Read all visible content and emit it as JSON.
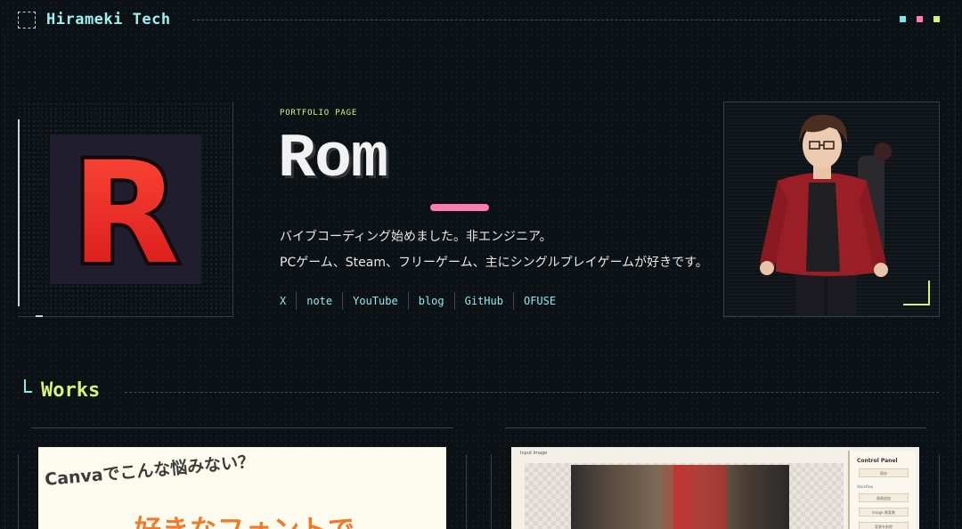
{
  "header": {
    "brand": "Hirameki Tech",
    "accent_squares": [
      "#7fe6e8",
      "#ff7ab0",
      "#d9f27a"
    ]
  },
  "hero": {
    "eyebrow": "PORTFOLIO PAGE",
    "name": "Rom",
    "avatar_letter": "R",
    "description": [
      "バイブコーディング始めました。非エンジニア。",
      "PCゲーム、Steam、フリーゲーム、主にシングルプレイゲームが好きです。"
    ],
    "links": [
      "X",
      "note",
      "YouTube",
      "blog",
      "GitHub",
      "OFUSE"
    ]
  },
  "works": {
    "title": "Works",
    "cards": [
      {
        "headline": "Canvaでこんな悩みない？",
        "subheadline": "好きなフォントで"
      },
      {
        "caption": "Input Image",
        "panel_title": "Control Panel",
        "panel_button": "保存",
        "panel_label": "Workflow",
        "panel_button2": "画像追加",
        "panel_select": "Image   黒背景",
        "panel_button3": "背景を削除"
      }
    ]
  },
  "colors": {
    "accent_cyan": "#8fe8ec",
    "accent_lime": "#d9f27a",
    "accent_pink": "#ff7ab0",
    "background": "#0c1116"
  }
}
